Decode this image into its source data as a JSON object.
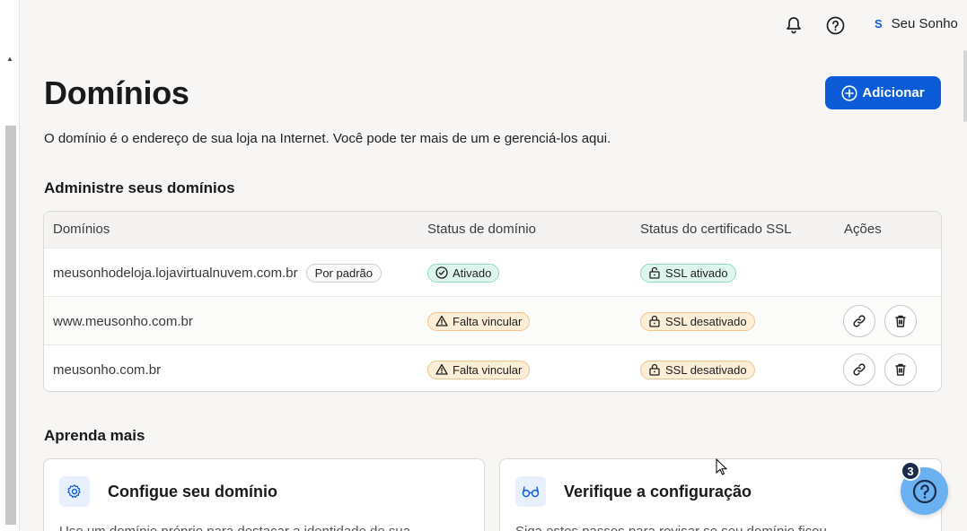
{
  "header": {
    "user_initial": "S",
    "user_name": "Seu Sonho"
  },
  "page": {
    "title": "Domínios",
    "add_button_label": "Adicionar",
    "subtitle": "O domínio é o endereço de sua loja na Internet. Você pode ter mais de um e gerenciá-los aqui."
  },
  "manage": {
    "section_title": "Administre seus domínios",
    "columns": [
      "Domínios",
      "Status de domínio",
      "Status do certificado SSL",
      "Ações"
    ],
    "rows": [
      {
        "domain": "meusonhodeloja.lojavirtualnuvem.com.br",
        "default_label": "Por padrão",
        "status": "Ativado",
        "ssl": "SSL ativado"
      },
      {
        "domain": "www.meusonho.com.br",
        "status": "Falta vincular",
        "ssl": "SSL desativado"
      },
      {
        "domain": "meusonho.com.br",
        "status": "Falta vincular",
        "ssl": "SSL desativado"
      }
    ]
  },
  "learn": {
    "section_title": "Aprenda mais",
    "cards": [
      {
        "title": "Configue seu domínio",
        "text": "Use um domínio próprio para destacar a identidade de sua"
      },
      {
        "title": "Verifique a configuração",
        "text": "Siga estes passos para revisar se seu domínio ficou"
      }
    ]
  },
  "help_fab": {
    "count": "3"
  },
  "colors": {
    "primary": "#0b5cd6",
    "success_bg": "#dff6ef",
    "warning_bg": "#fdeed8",
    "fab": "#6ab1f2"
  }
}
